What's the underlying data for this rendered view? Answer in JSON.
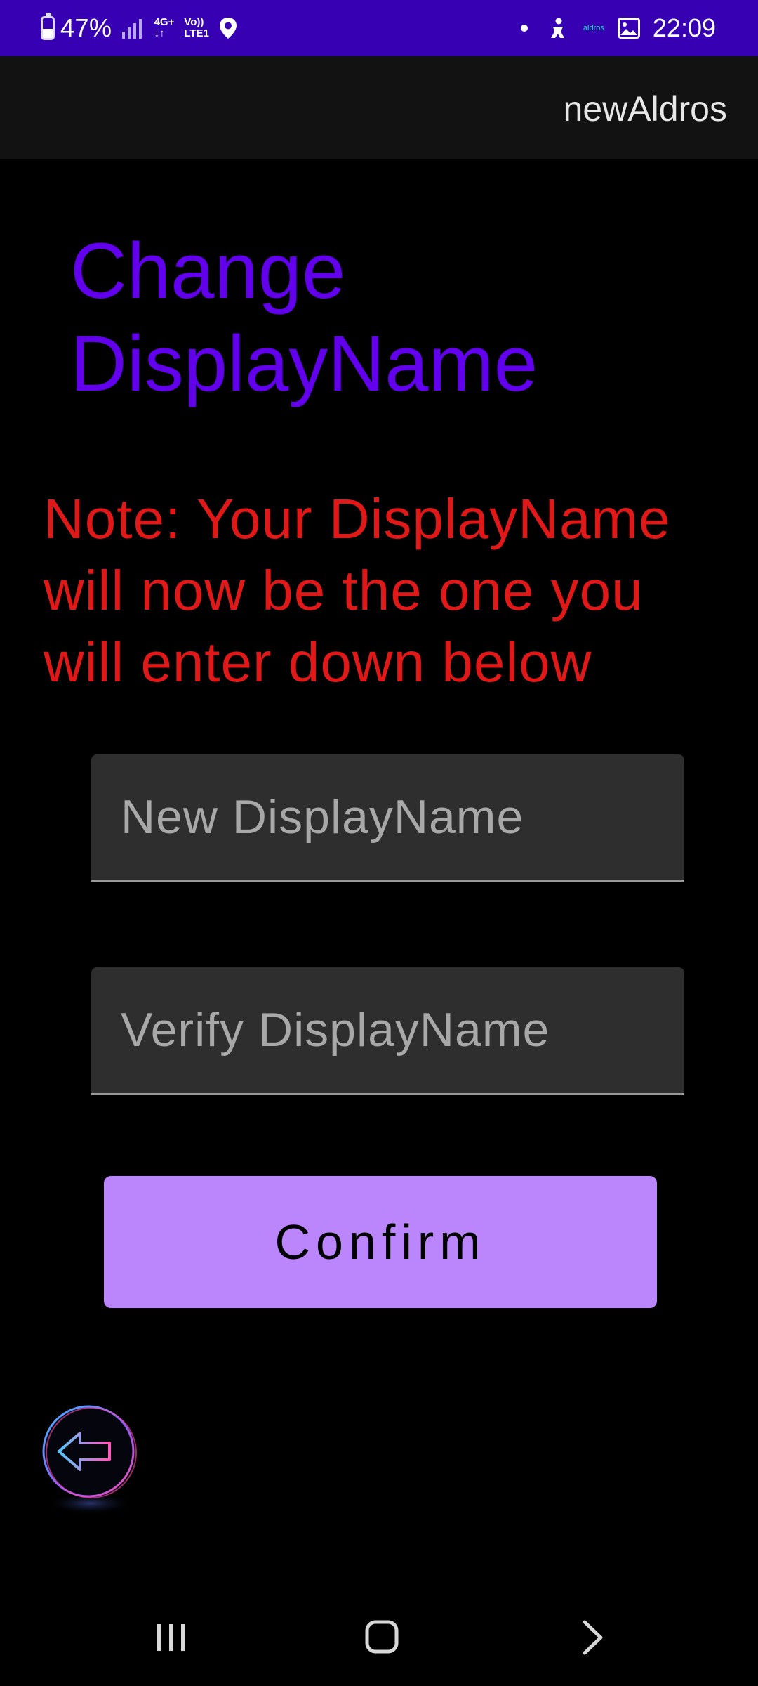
{
  "status_bar": {
    "battery_percent": "47%",
    "network_type": "4G+",
    "network_arrows": "↓↑",
    "volte_label": "Vo))",
    "lte_label": "LTE1",
    "app_mini_label": "aldros",
    "time": "22:09",
    "background_color": "#3700B3"
  },
  "app_bar": {
    "title": "newAldros"
  },
  "page": {
    "title_line1": "Change",
    "title_line2": "DisplayName",
    "note": "Note: Your DisplayName will now be the one you will enter down below",
    "title_color": "#6200EE",
    "note_color": "#E01818"
  },
  "form": {
    "new_display_name": {
      "value": "",
      "placeholder": "New DisplayName"
    },
    "verify_display_name": {
      "value": "",
      "placeholder": "Verify DisplayName"
    },
    "confirm_label": "Confirm",
    "confirm_color": "#BB86FC"
  },
  "icons": {
    "back_button": "arrow-left-circle-icon",
    "nav_recent": "recent-apps-icon",
    "nav_home": "home-icon",
    "nav_back": "chevron-right-icon"
  }
}
